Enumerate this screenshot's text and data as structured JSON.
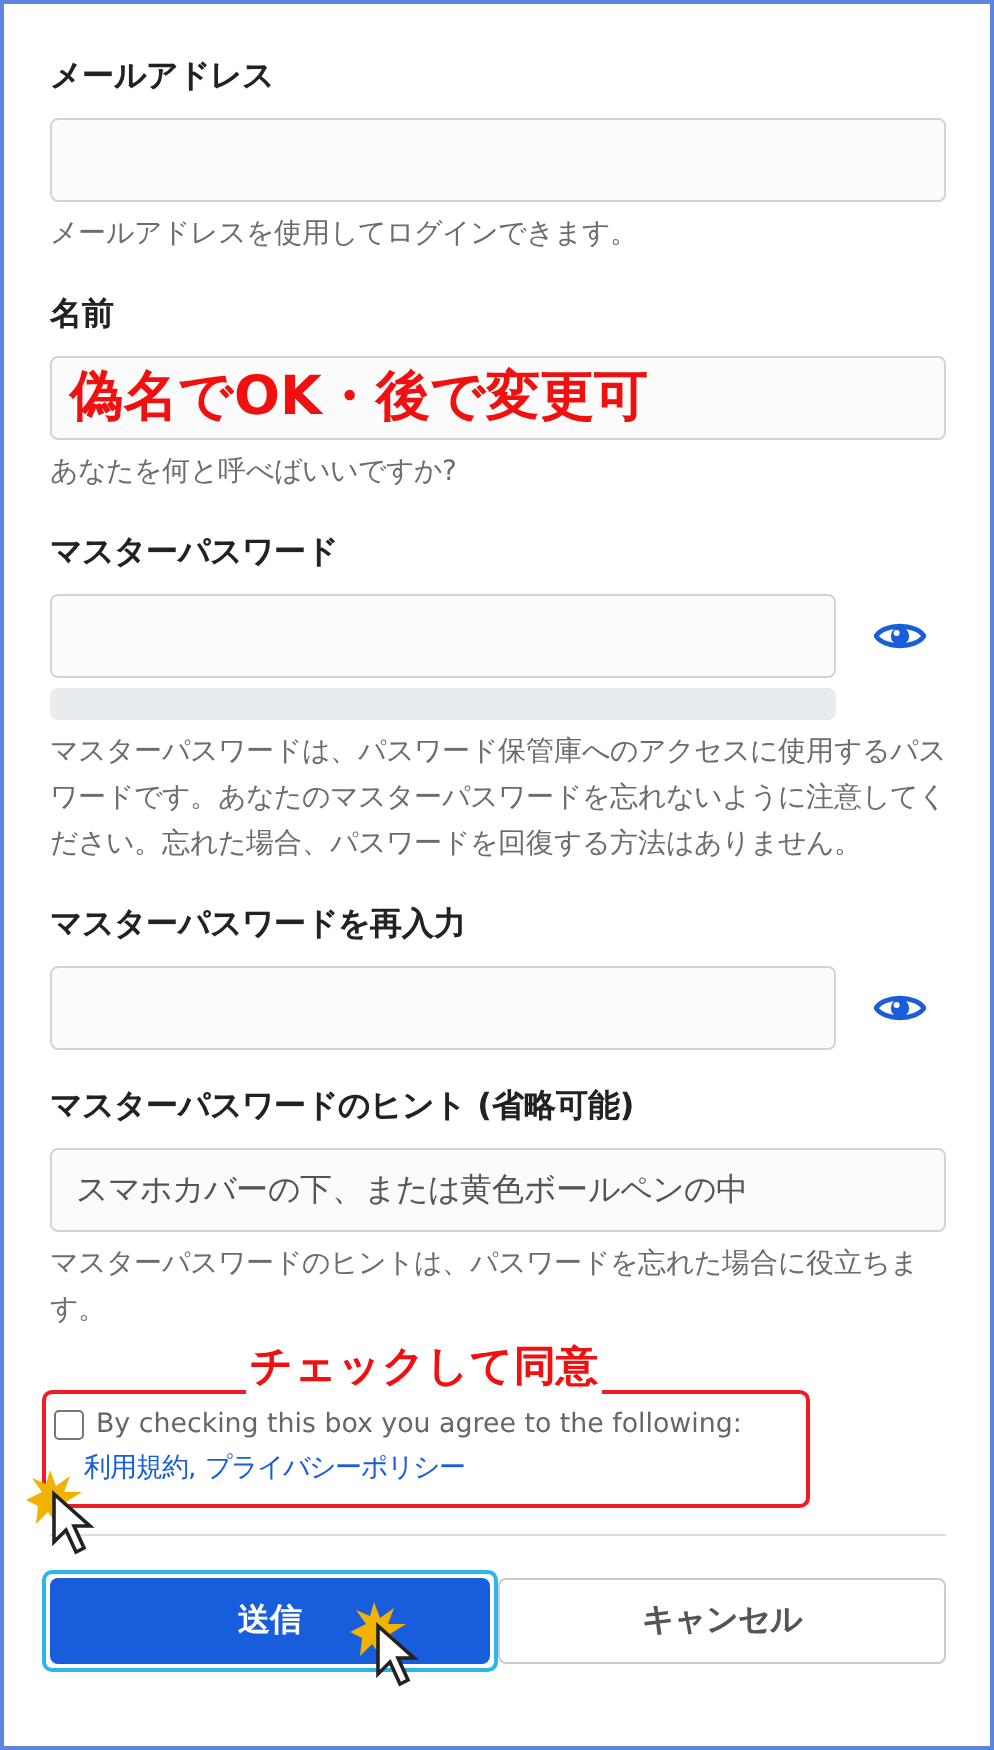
{
  "fields": [
    {
      "kind": "text",
      "label": "メールアドレス",
      "help": "メールアドレスを使用してログインできます。"
    },
    {
      "kind": "text",
      "label": "名前",
      "annotation": "偽名でOK・後で変更可",
      "help": "あなたを何と呼べばいいですか?"
    },
    {
      "kind": "password",
      "label": "マスターパスワード",
      "strength_meter": true,
      "help": "マスターパスワードは、パスワード保管庫へのアクセスに使用するパスワードです。あなたのマスターパスワードを忘れないように注意してください。忘れた場合、パスワードを回復する方法はありません。"
    },
    {
      "kind": "password",
      "label": "マスターパスワードを再入力"
    },
    {
      "kind": "text",
      "label": "マスターパスワードのヒント (省略可能)",
      "value": "スマホカバーの下、または黄色ボールペンの中",
      "help": "マスターパスワードのヒントは、パスワードを忘れた場合に役立ちます。"
    }
  ],
  "agreement": {
    "annotation": "チェックして同意",
    "checked": false,
    "text": "By checking this box you agree to the following:",
    "links": [
      "利用規約,",
      "プライバシーポリシー"
    ]
  },
  "buttons": [
    {
      "kind": "primary",
      "label": "送信",
      "highlighted": true
    },
    {
      "kind": "secondary",
      "label": "キャンセル",
      "highlighted": false
    }
  ]
}
